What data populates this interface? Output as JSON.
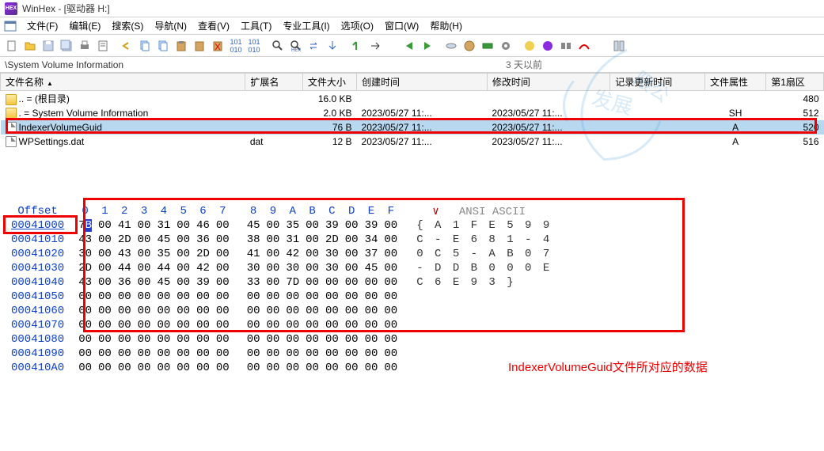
{
  "window": {
    "title": "WinHex - [驱动器 H:]"
  },
  "menu": {
    "items": [
      "文件(F)",
      "编辑(E)",
      "搜索(S)",
      "导航(N)",
      "查看(V)",
      "工具(T)",
      "专业工具(I)",
      "选项(O)",
      "窗口(W)",
      "帮助(H)"
    ]
  },
  "pathbar": {
    "path": "\\System Volume Information",
    "time": "3 天以前"
  },
  "columns": {
    "name": "文件名称",
    "ext": "扩展名",
    "size": "文件大小",
    "ctime": "创建时间",
    "mtime": "修改时间",
    "rtime": "记录更新时间",
    "attr": "文件属性",
    "sect": "第1扇区"
  },
  "files": [
    {
      "icon": "folder",
      "name": ".. =  (根目录)",
      "ext": "",
      "size": "16.0 KB",
      "ctime": "",
      "mtime": "",
      "rtime": "",
      "attr": "",
      "sect": "480"
    },
    {
      "icon": "folder",
      "name": ". =   System Volume Information",
      "ext": "",
      "size": "2.0 KB",
      "ctime": "2023/05/27  11:...",
      "mtime": "2023/05/27  11:...",
      "rtime": "",
      "attr": "SH",
      "sect": "512"
    },
    {
      "icon": "file",
      "name": "IndexerVolumeGuid",
      "ext": "",
      "size": "76 B",
      "ctime": "2023/05/27  11:...",
      "mtime": "2023/05/27  11:...",
      "rtime": "",
      "attr": "A",
      "sect": "520",
      "sel": true
    },
    {
      "icon": "file",
      "name": "WPSettings.dat",
      "ext": "dat",
      "size": "12 B",
      "ctime": "2023/05/27  11:...",
      "mtime": "2023/05/27  11:...",
      "rtime": "",
      "attr": "A",
      "sect": "516"
    }
  ],
  "hex": {
    "offset_label": "Offset",
    "ansi_label": "ANSI ASCII",
    "cols": [
      "0",
      "1",
      "2",
      "3",
      "4",
      "5",
      "6",
      "7",
      "8",
      "9",
      "A",
      "B",
      "C",
      "D",
      "E",
      "F"
    ],
    "rows": [
      {
        "off": "00041000",
        "b": [
          "7B",
          "00",
          "41",
          "00",
          "31",
          "00",
          "46",
          "00",
          "45",
          "00",
          "35",
          "00",
          "39",
          "00",
          "39",
          "00"
        ],
        "a": "{ A 1 F E 5 9 9"
      },
      {
        "off": "00041010",
        "b": [
          "43",
          "00",
          "2D",
          "00",
          "45",
          "00",
          "36",
          "00",
          "38",
          "00",
          "31",
          "00",
          "2D",
          "00",
          "34",
          "00"
        ],
        "a": "C - E 6 8 1 - 4"
      },
      {
        "off": "00041020",
        "b": [
          "30",
          "00",
          "43",
          "00",
          "35",
          "00",
          "2D",
          "00",
          "41",
          "00",
          "42",
          "00",
          "30",
          "00",
          "37",
          "00"
        ],
        "a": "0 C 5 - A B 0 7"
      },
      {
        "off": "00041030",
        "b": [
          "2D",
          "00",
          "44",
          "00",
          "44",
          "00",
          "42",
          "00",
          "30",
          "00",
          "30",
          "00",
          "30",
          "00",
          "45",
          "00"
        ],
        "a": "- D D B 0 0 0 E"
      },
      {
        "off": "00041040",
        "b": [
          "43",
          "00",
          "36",
          "00",
          "45",
          "00",
          "39",
          "00",
          "33",
          "00",
          "7D",
          "00",
          "00",
          "00",
          "00",
          "00"
        ],
        "a": "C 6 E 9 3 }    "
      },
      {
        "off": "00041050",
        "b": [
          "00",
          "00",
          "00",
          "00",
          "00",
          "00",
          "00",
          "00",
          "00",
          "00",
          "00",
          "00",
          "00",
          "00",
          "00",
          "00"
        ],
        "a": ""
      },
      {
        "off": "00041060",
        "b": [
          "00",
          "00",
          "00",
          "00",
          "00",
          "00",
          "00",
          "00",
          "00",
          "00",
          "00",
          "00",
          "00",
          "00",
          "00",
          "00"
        ],
        "a": ""
      },
      {
        "off": "00041070",
        "b": [
          "00",
          "00",
          "00",
          "00",
          "00",
          "00",
          "00",
          "00",
          "00",
          "00",
          "00",
          "00",
          "00",
          "00",
          "00",
          "00"
        ],
        "a": ""
      },
      {
        "off": "00041080",
        "b": [
          "00",
          "00",
          "00",
          "00",
          "00",
          "00",
          "00",
          "00",
          "00",
          "00",
          "00",
          "00",
          "00",
          "00",
          "00",
          "00"
        ],
        "a": ""
      },
      {
        "off": "00041090",
        "b": [
          "00",
          "00",
          "00",
          "00",
          "00",
          "00",
          "00",
          "00",
          "00",
          "00",
          "00",
          "00",
          "00",
          "00",
          "00",
          "00"
        ],
        "a": ""
      },
      {
        "off": "000410A0",
        "b": [
          "00",
          "00",
          "00",
          "00",
          "00",
          "00",
          "00",
          "00",
          "00",
          "00",
          "00",
          "00",
          "00",
          "00",
          "00",
          "00"
        ],
        "a": ""
      }
    ]
  },
  "annotation": {
    "label": "IndexerVolumeGuid文件所对应的数据"
  }
}
